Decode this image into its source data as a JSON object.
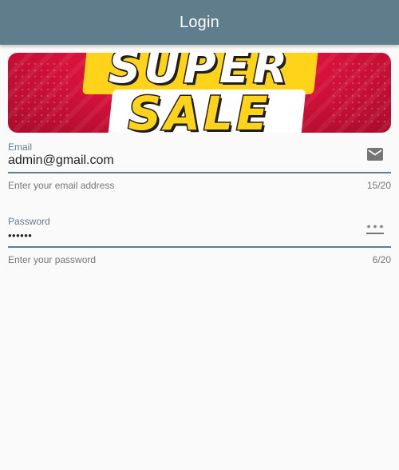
{
  "appbar": {
    "title": "Login"
  },
  "banner": {
    "line1": "SUPER",
    "line2": "SALE"
  },
  "email_field": {
    "label": "Email",
    "value": "admin@gmail.com",
    "helper": "Enter your email address",
    "counter": "15/20",
    "icon": "mail-icon"
  },
  "password_field": {
    "label": "Password",
    "value": "••••••",
    "helper": "Enter your password",
    "counter": "6/20",
    "icon": "password-icon"
  },
  "colors": {
    "primary": "#607d8b",
    "background": "#fafafa",
    "text": "#212121",
    "helper_text": "#757575"
  }
}
